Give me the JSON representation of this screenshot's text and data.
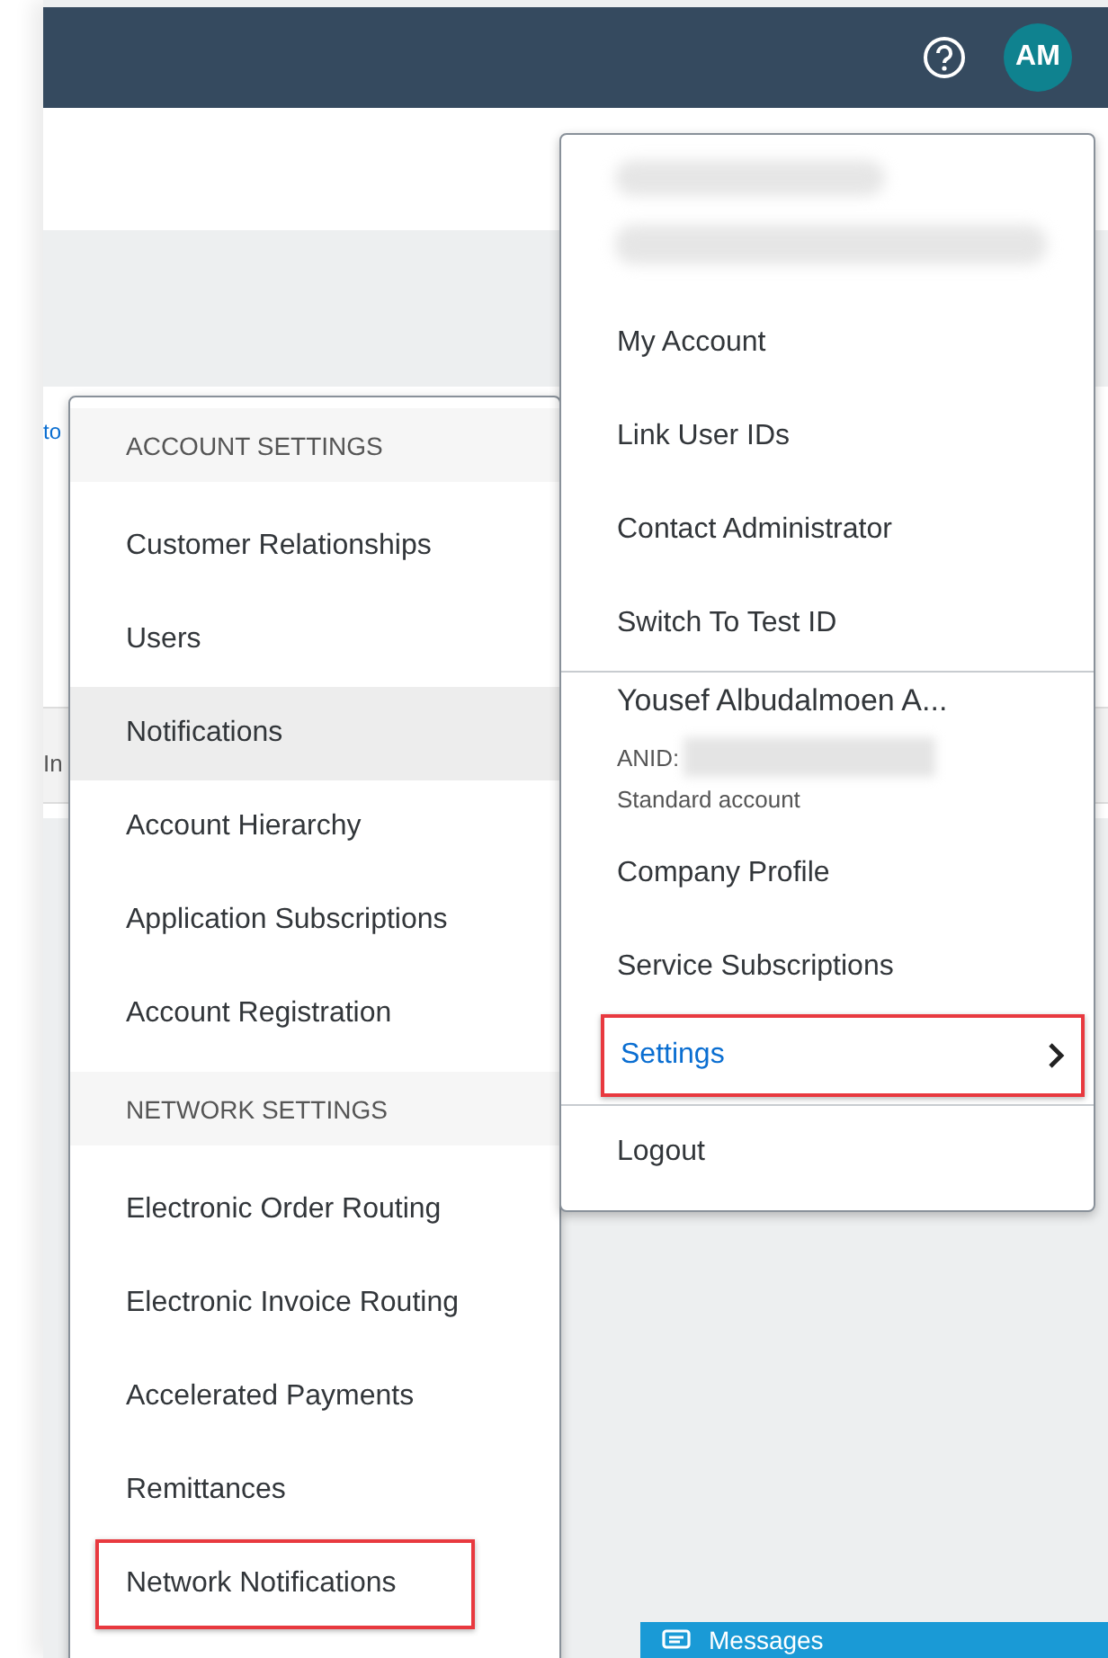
{
  "header": {
    "avatar_initials": "AM"
  },
  "background_fragments": [
    "to",
    "In"
  ],
  "account_menu": {
    "sections": [
      {
        "items": [
          {
            "kind": "redacted"
          },
          {
            "kind": "link",
            "label": "My Account"
          },
          {
            "kind": "link",
            "label": "Link User IDs"
          },
          {
            "kind": "link",
            "label": "Contact Administrator"
          },
          {
            "kind": "link",
            "label": "Switch To Test ID"
          }
        ]
      },
      {
        "items": [
          {
            "kind": "profile",
            "name": "Yousef Albudalmoen A...",
            "anid_label": "ANID:",
            "account_type": "Standard account"
          },
          {
            "kind": "link",
            "label": "Company Profile"
          },
          {
            "kind": "link",
            "label": "Service Subscriptions"
          },
          {
            "kind": "submenu",
            "label": "Settings",
            "expanded": true,
            "highlighted": true
          }
        ]
      },
      {
        "items": [
          {
            "kind": "link",
            "label": "Logout"
          }
        ]
      }
    ]
  },
  "settings_menu": {
    "groups": [
      {
        "heading": "ACCOUNT SETTINGS",
        "items": [
          {
            "label": "Customer Relationships",
            "selected": false,
            "highlighted": false
          },
          {
            "label": "Users",
            "selected": false,
            "highlighted": false
          },
          {
            "label": "Notifications",
            "selected": true,
            "highlighted": false
          },
          {
            "label": "Account Hierarchy",
            "selected": false,
            "highlighted": false
          },
          {
            "label": "Application Subscriptions",
            "selected": false,
            "highlighted": false
          },
          {
            "label": "Account Registration",
            "selected": false,
            "highlighted": false
          }
        ]
      },
      {
        "heading": "NETWORK SETTINGS",
        "items": [
          {
            "label": "Electronic Order Routing",
            "selected": false,
            "highlighted": false
          },
          {
            "label": "Electronic Invoice Routing",
            "selected": false,
            "highlighted": false
          },
          {
            "label": "Accelerated Payments",
            "selected": false,
            "highlighted": false
          },
          {
            "label": "Remittances",
            "selected": false,
            "highlighted": false
          },
          {
            "label": "Network Notifications",
            "selected": false,
            "highlighted": true
          }
        ]
      }
    ]
  },
  "messages_bar": {
    "label": "Messages"
  }
}
